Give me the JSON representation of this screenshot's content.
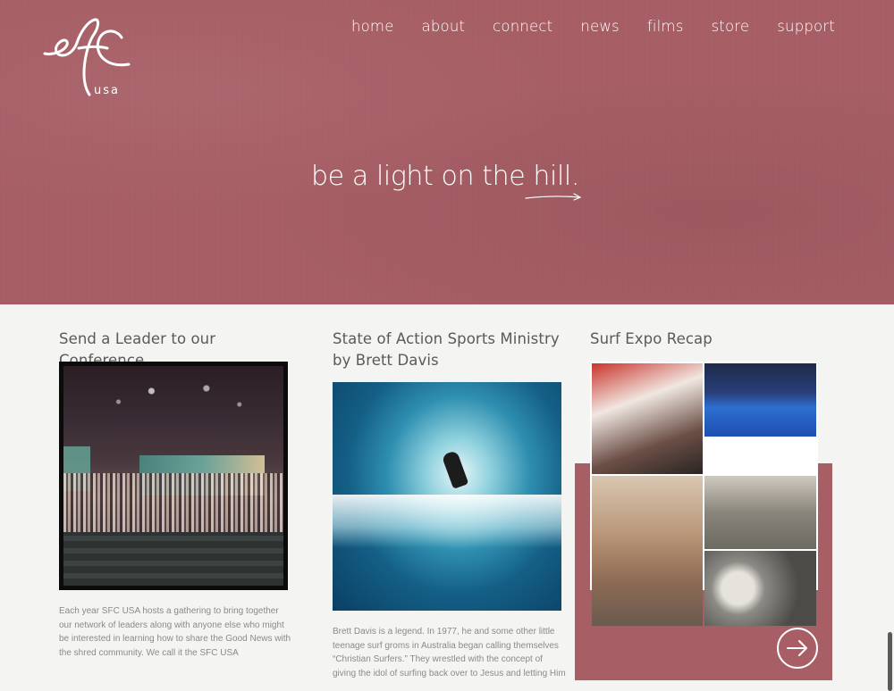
{
  "logo": {
    "mark": "sfc",
    "sub": "usa"
  },
  "nav": [
    {
      "label": "home"
    },
    {
      "label": "about"
    },
    {
      "label": "connect"
    },
    {
      "label": "news"
    },
    {
      "label": "films"
    },
    {
      "label": "store"
    },
    {
      "label": "support"
    }
  ],
  "hero": {
    "tagline": "be a light on the hill."
  },
  "articles": [
    {
      "title": "Send a Leader to our Conference",
      "body": "Each year SFC USA hosts a gathering to bring together our network of leaders along with anyone else who might be interested in learning how to share the Good News with the shred community.  We call it the SFC USA"
    },
    {
      "title": "State of Action Sports Ministry by Brett Davis",
      "body": "Brett Davis is a legend. In 1977, he and some other little teenage surf groms in Australia began calling themselves “Christian Surfers.” They wrestled with the concept of giving the idol of surfing back over to Jesus and letting Him"
    },
    {
      "title": "Surf Expo Recap"
    }
  ],
  "colors": {
    "brand": "#a75e65",
    "background": "#f4f4f3",
    "heading": "#5a5a5a",
    "body": "#8a8a8a"
  },
  "icons": {
    "next": "arrow-right-icon",
    "tagline_underline": "hand-drawn-arrow-icon"
  }
}
